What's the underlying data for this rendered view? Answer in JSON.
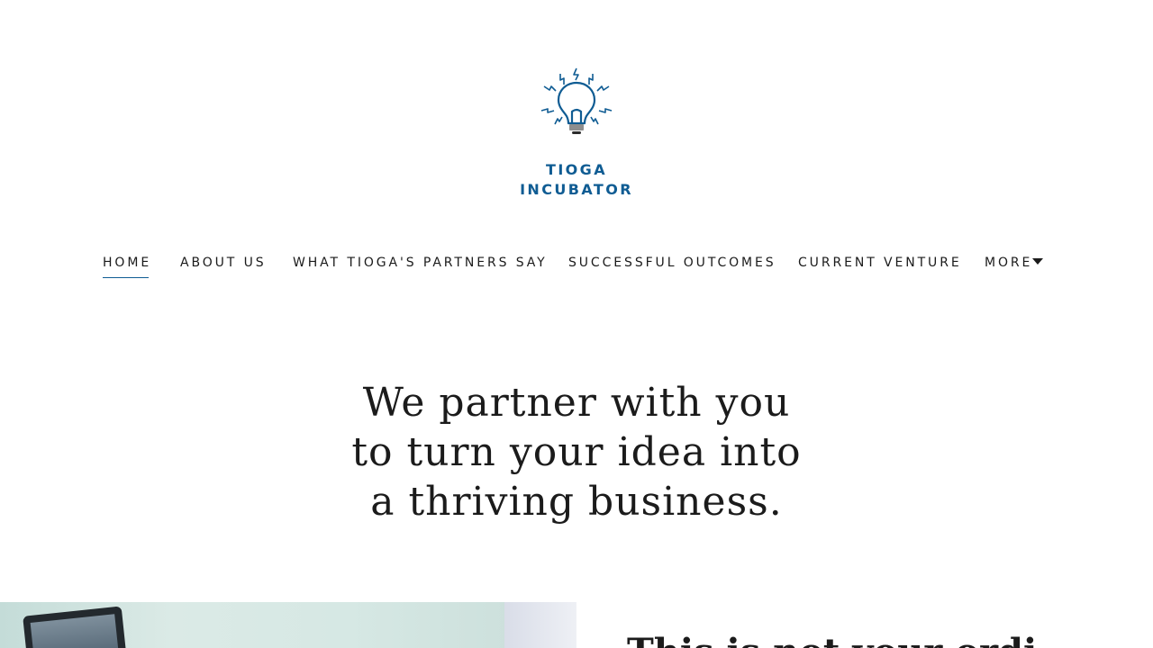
{
  "brand": {
    "logo_line1": "TIOGA",
    "logo_line2": "INCUBATOR",
    "logo_icon": "lightbulb-icon",
    "color": "#0f5c93"
  },
  "nav": {
    "items": [
      {
        "label": "HOME",
        "active": true
      },
      {
        "label": "ABOUT US"
      },
      {
        "label": "WHAT TIOGA'S PARTNERS SAY"
      },
      {
        "label": "SUCCESSFUL OUTCOMES"
      },
      {
        "label": "CURRENT VENTURE"
      },
      {
        "label": "MORE",
        "icon": "caret-down-icon"
      }
    ]
  },
  "hero": {
    "line1": "We partner with you",
    "line2": "to turn your idea into",
    "line3": "a thriving business."
  },
  "section": {
    "title_partial": "This is not your ordi"
  }
}
